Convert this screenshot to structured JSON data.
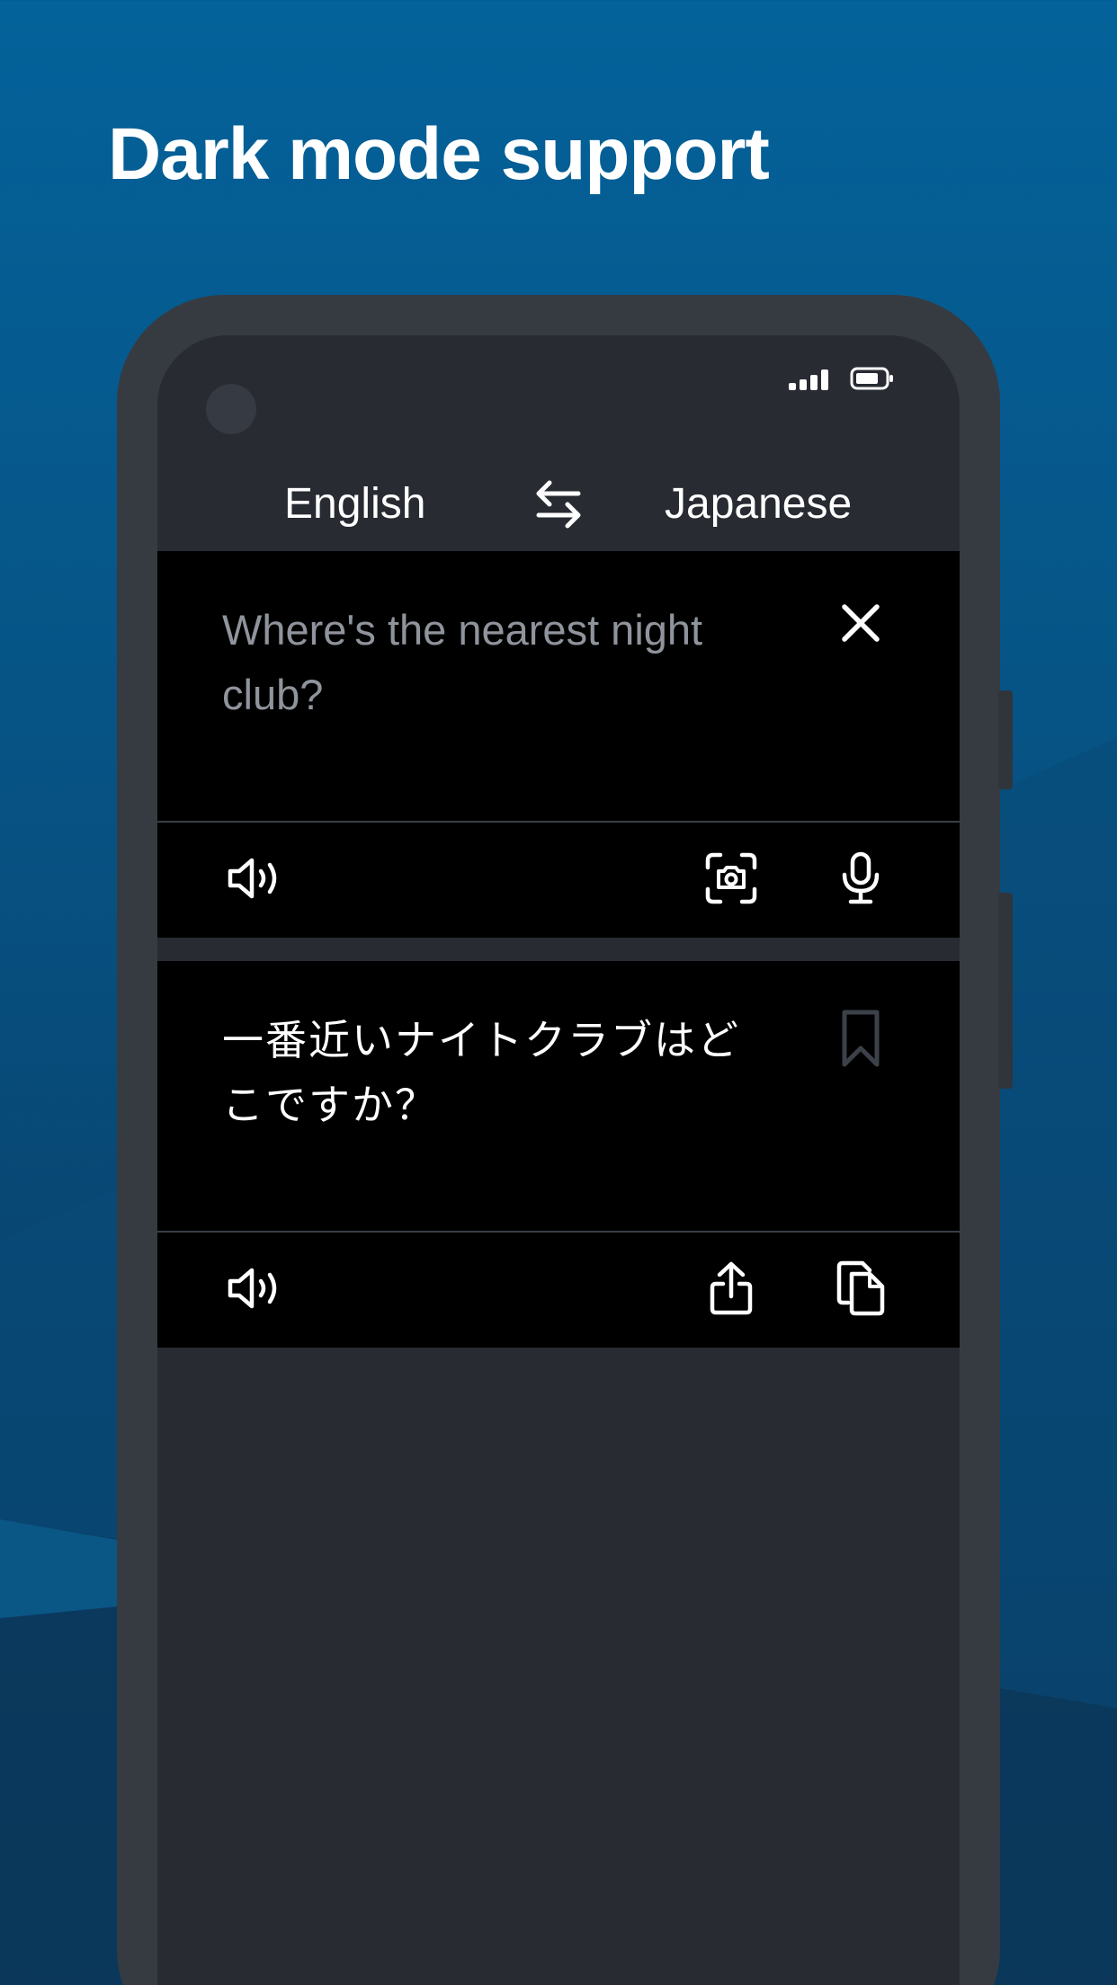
{
  "headline": "Dark mode support",
  "colors": {
    "background_top": "#04629a",
    "background_bottom": "#0b3253",
    "phone_frame": "#363b42",
    "screen": "#282b32",
    "panel": "#000000",
    "placeholder_text": "#8f949c",
    "text": "#ffffff"
  },
  "status_bar": {
    "icons": [
      "signal-icon",
      "battery-icon"
    ]
  },
  "language_bar": {
    "source": "English",
    "target": "Japanese",
    "swap_icon": "swap-arrows-icon"
  },
  "input_panel": {
    "text": "Where's the nearest night club?",
    "clear_icon": "close-icon"
  },
  "input_toolbar": {
    "icons": [
      "speaker-icon",
      "camera-scan-icon",
      "microphone-icon"
    ]
  },
  "output_panel": {
    "text": "一番近いナイトクラブはどこですか？",
    "bookmark_icon": "bookmark-icon"
  },
  "output_toolbar": {
    "icons": [
      "speaker-icon",
      "share-icon",
      "copy-icon"
    ]
  }
}
